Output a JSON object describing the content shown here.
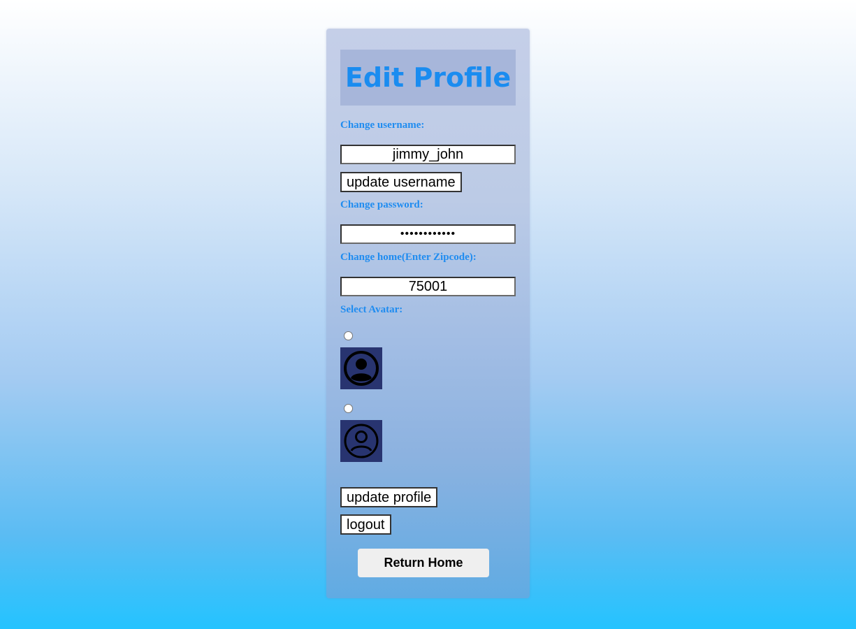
{
  "title": "Edit Profile",
  "username": {
    "label": "Change username:",
    "value": "jimmy_john",
    "button": "update username"
  },
  "password": {
    "label": "Change password:",
    "value": "••••••••••••"
  },
  "home": {
    "label": "Change home(Enter Zipcode):",
    "value": "75001"
  },
  "avatar": {
    "label": "Select Avatar:",
    "options": [
      {
        "icon": "user-circle-filled-icon",
        "selected": false
      },
      {
        "icon": "user-circle-outline-icon",
        "selected": false
      }
    ]
  },
  "actions": {
    "update_profile": "update profile",
    "logout": "logout",
    "return_home": "Return Home"
  },
  "colors": {
    "title": "#1a8cf0",
    "label": "#1f8cf0",
    "avatar_bg": "#283470"
  }
}
